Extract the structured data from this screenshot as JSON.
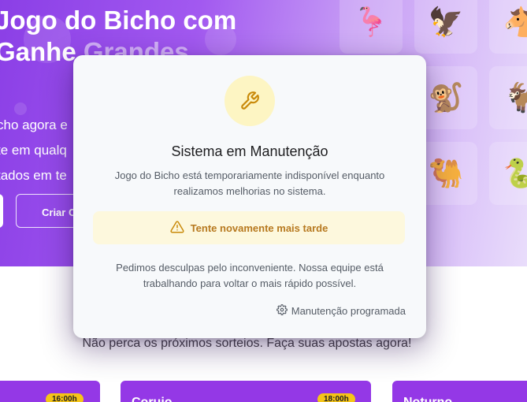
{
  "hero": {
    "title_line1": "Jogo do Bicho com",
    "title_line2a": "Ganhe ",
    "title_line2b": "Grandes",
    "sub_line1": "cho agora e",
    "sub_line2": "te em qualq",
    "sub_line3": "tados em te",
    "btn_create": "Criar C"
  },
  "animals": [
    {
      "name": "flamingo",
      "emoji": "🦩"
    },
    {
      "name": "aguia",
      "emoji": "🦅"
    },
    {
      "name": "cavalo",
      "emoji": "🐴"
    },
    {
      "name": "macaco",
      "emoji": "🐒"
    },
    {
      "name": "cabra",
      "emoji": "🐐"
    },
    {
      "name": "camelo",
      "emoji": "🐫"
    },
    {
      "name": "cobra",
      "emoji": "🐍"
    }
  ],
  "tagline": "Não perca os próximos sorteios. Faça suas apostas agora!",
  "draws": [
    {
      "name": "",
      "time": "16:00h"
    },
    {
      "name": "Corujo",
      "time": "18:00h"
    },
    {
      "name": "Noturno",
      "time": ""
    }
  ],
  "modal": {
    "title": "Sistema em Manutenção",
    "description": "Jogo do Bicho está temporariamente indisponível enquanto realizamos melhorias no sistema.",
    "alert": "Tente novamente mais tarde",
    "apology": "Pedimos desculpas pelo inconveniente. Nossa equipe está trabalhando para voltar o mais rápido possível.",
    "footer": "Manutenção programada"
  },
  "colors": {
    "hero_start": "#8b3fe6",
    "accent_yellow": "#f5c518",
    "alert_text": "#b7791f"
  }
}
